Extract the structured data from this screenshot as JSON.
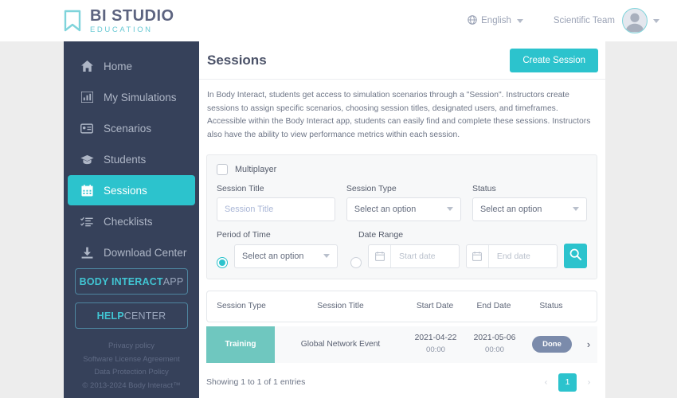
{
  "header": {
    "brand_title": "BI STUDIO",
    "brand_sub": "EDUCATION",
    "brand_icon": "bookmark-icon",
    "language": "English",
    "language_icon": "globe-icon",
    "user_name": "Scientific Team",
    "avatar_icon": "user-avatar-icon"
  },
  "sidebar": {
    "items": [
      {
        "label": "Home",
        "icon": "home-icon",
        "active": false
      },
      {
        "label": "My Simulations",
        "icon": "chart-bar-icon",
        "active": false
      },
      {
        "label": "Scenarios",
        "icon": "id-card-icon",
        "active": false
      },
      {
        "label": "Students",
        "icon": "graduation-cap-icon",
        "active": false
      },
      {
        "label": "Sessions",
        "icon": "calendar-icon",
        "active": true
      },
      {
        "label": "Checklists",
        "icon": "list-check-icon",
        "active": false
      },
      {
        "label": "Download Center",
        "icon": "download-icon",
        "active": false
      }
    ],
    "buttons": [
      {
        "strong": "BODY INTERACT",
        "rest": " APP"
      },
      {
        "strong": "HELP",
        "rest": " CENTER"
      }
    ],
    "footer_links": [
      "Privacy policy",
      "Software License Agreement",
      "Data Protection Policy"
    ],
    "copyright": "© 2013-2024 Body Interact™"
  },
  "main": {
    "title": "Sessions",
    "create_button": "Create Session",
    "intro": "In Body Interact, students get access to simulation scenarios through a \"Session\". Instructors create sessions to assign specific scenarios, choosing session titles, designated users, and timeframes. Accessible within the Body Interact app, students can easily find and complete these sessions. Instructors also have the ability to view performance metrics within each session."
  },
  "filters": {
    "multiplayer_label": "Multiplayer",
    "multiplayer_checked": false,
    "session_title": {
      "label": "Session Title",
      "value": "",
      "placeholder": "Session Title"
    },
    "session_type": {
      "label": "Session Type",
      "value": "Select an option"
    },
    "status": {
      "label": "Status",
      "value": "Select an option"
    },
    "period_of_time": {
      "label": "Period of Time",
      "value": "Select an option",
      "selected": true
    },
    "date_range": {
      "label": "Date Range",
      "selected": false,
      "start_placeholder": "Start date",
      "end_placeholder": "End date",
      "start_value": "",
      "end_value": "",
      "calendar_icon": "calendar-icon"
    },
    "search_icon": "search-icon"
  },
  "table": {
    "columns": [
      "Session Type",
      "Session Title",
      "Start Date",
      "End Date",
      "Status"
    ],
    "rows": [
      {
        "type": "Training",
        "title": "Global Network Event",
        "start_date": "2021-04-22",
        "start_time": "00:00",
        "end_date": "2021-05-06",
        "end_time": "00:00",
        "status": "Done",
        "chevron": "chevron-right-icon"
      }
    ]
  },
  "pagination": {
    "info": "Showing 1 to 1 of 1 entries",
    "prev": "‹",
    "current_page": "1",
    "next": "›"
  },
  "colors": {
    "accent": "#2cc3cd",
    "sidebar_bg": "#36415a",
    "type_badge": "#6fc7bf",
    "status_badge": "#7b8bab",
    "page_bg": "#ededed"
  }
}
